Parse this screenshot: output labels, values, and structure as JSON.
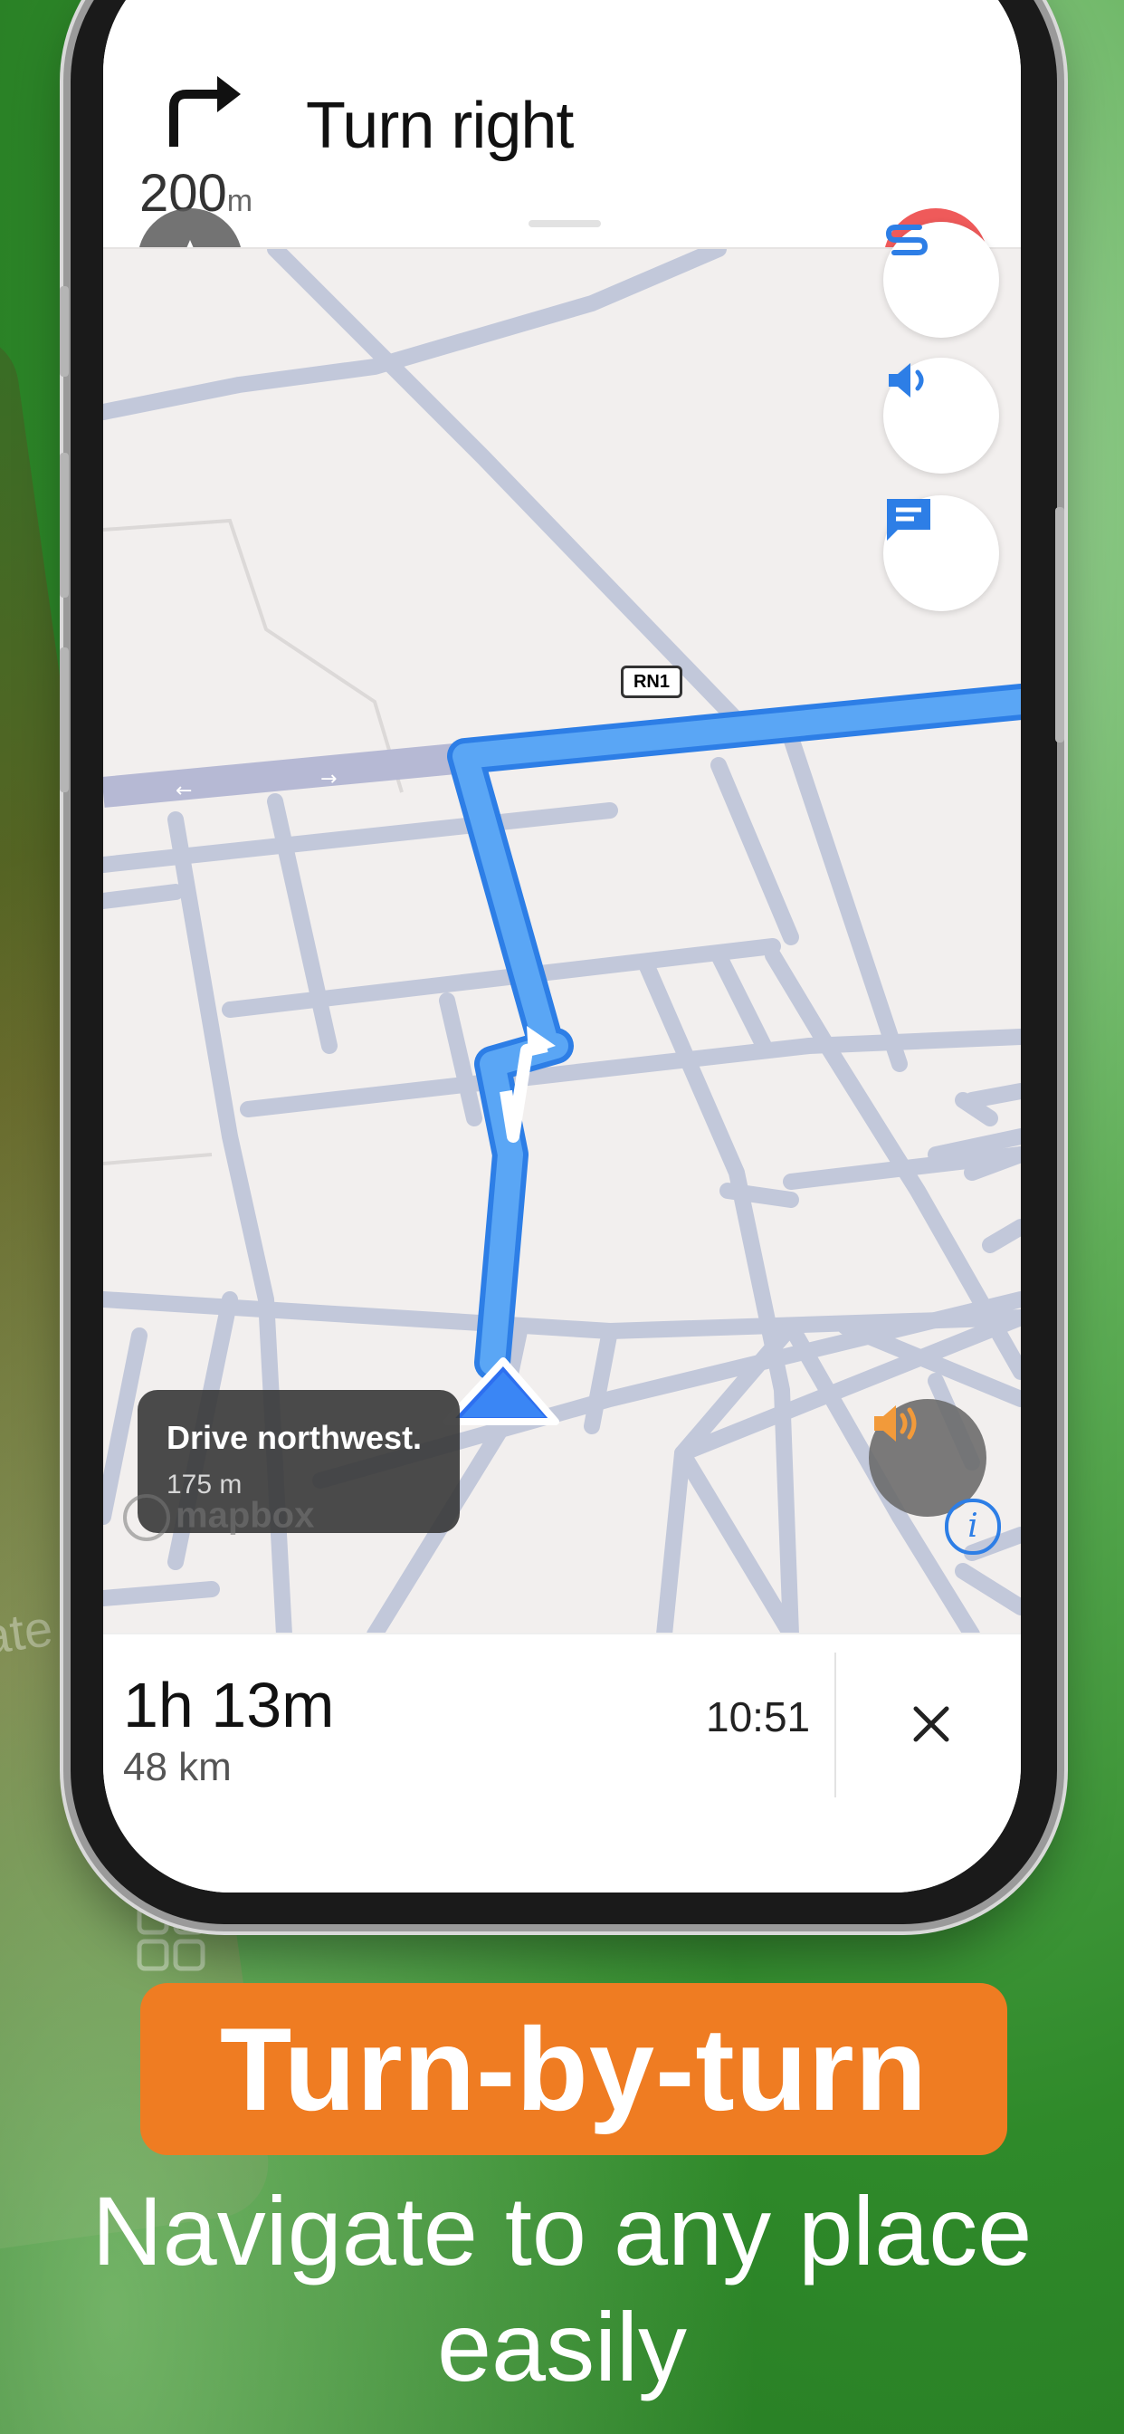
{
  "instruction": {
    "title": "Turn right",
    "distance_value": "200",
    "distance_unit": "m"
  },
  "map": {
    "road_label": "RN1",
    "maneuver_banner": {
      "title": "Drive northwest.",
      "distance": "175 m"
    },
    "attribution": "mapbox"
  },
  "trip": {
    "duration": "1h 13m",
    "distance": "48 km",
    "arrival_time": "10:51"
  },
  "marketing": {
    "headline": "Turn-by-turn",
    "subheadline": "Navigate to any place easily"
  },
  "colors": {
    "route": "#5aa6f5",
    "route_border": "#2d7ee6",
    "accent_orange": "#ef7c22",
    "close_red": "#ef5a5a"
  },
  "icons": [
    "turn-right-icon",
    "close-icon",
    "route-overview-icon",
    "volume-icon",
    "chat-icon",
    "compass-icon",
    "sound-icon",
    "info-icon",
    "mapbox-logo-icon"
  ]
}
